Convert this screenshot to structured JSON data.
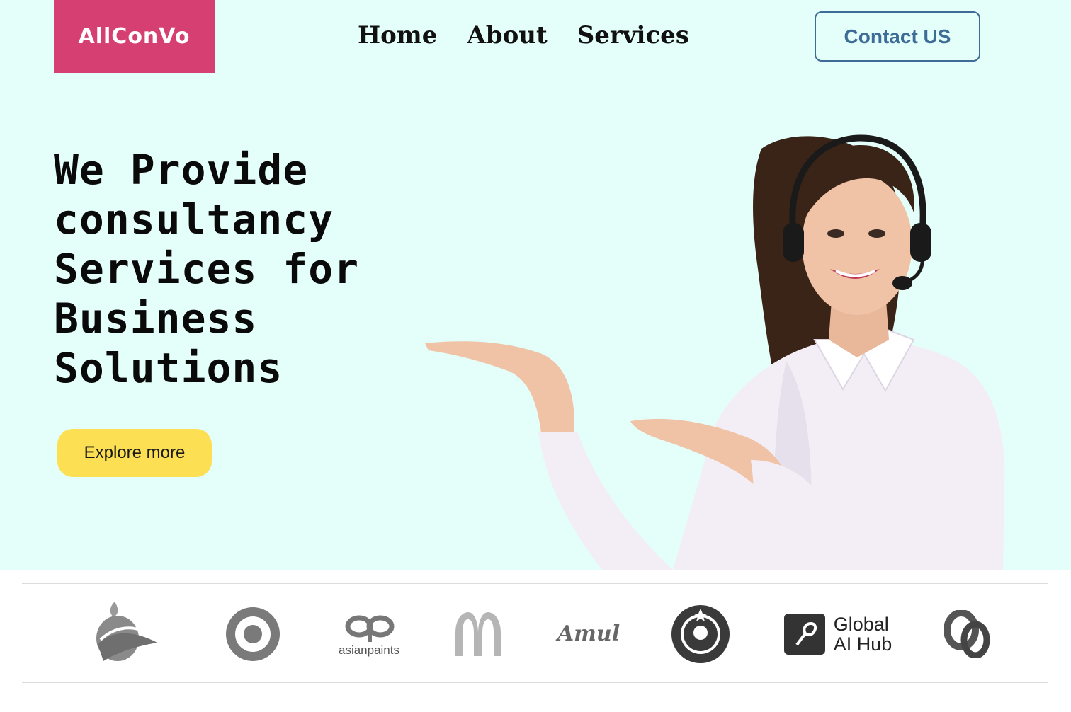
{
  "header": {
    "logo_text": "AllConVo",
    "nav": [
      "Home",
      "About",
      "Services"
    ],
    "contact_label": "Contact US"
  },
  "hero": {
    "headline_lines": [
      "We Provide",
      "consultancy",
      "Services for",
      "Business",
      "Solutions"
    ],
    "cta_label": "Explore more",
    "image": "customer-support-agent-with-headset"
  },
  "brands": {
    "asianpaints_text": "asianpaints",
    "amul_text": "Amul",
    "globalai_line1": "Global",
    "globalai_line2": "AI Hub"
  },
  "colors": {
    "hero_bg": "#e4fef9",
    "logo_bg": "#d63f72",
    "contact_border": "#3d6c97",
    "cta_bg": "#fddf53"
  }
}
